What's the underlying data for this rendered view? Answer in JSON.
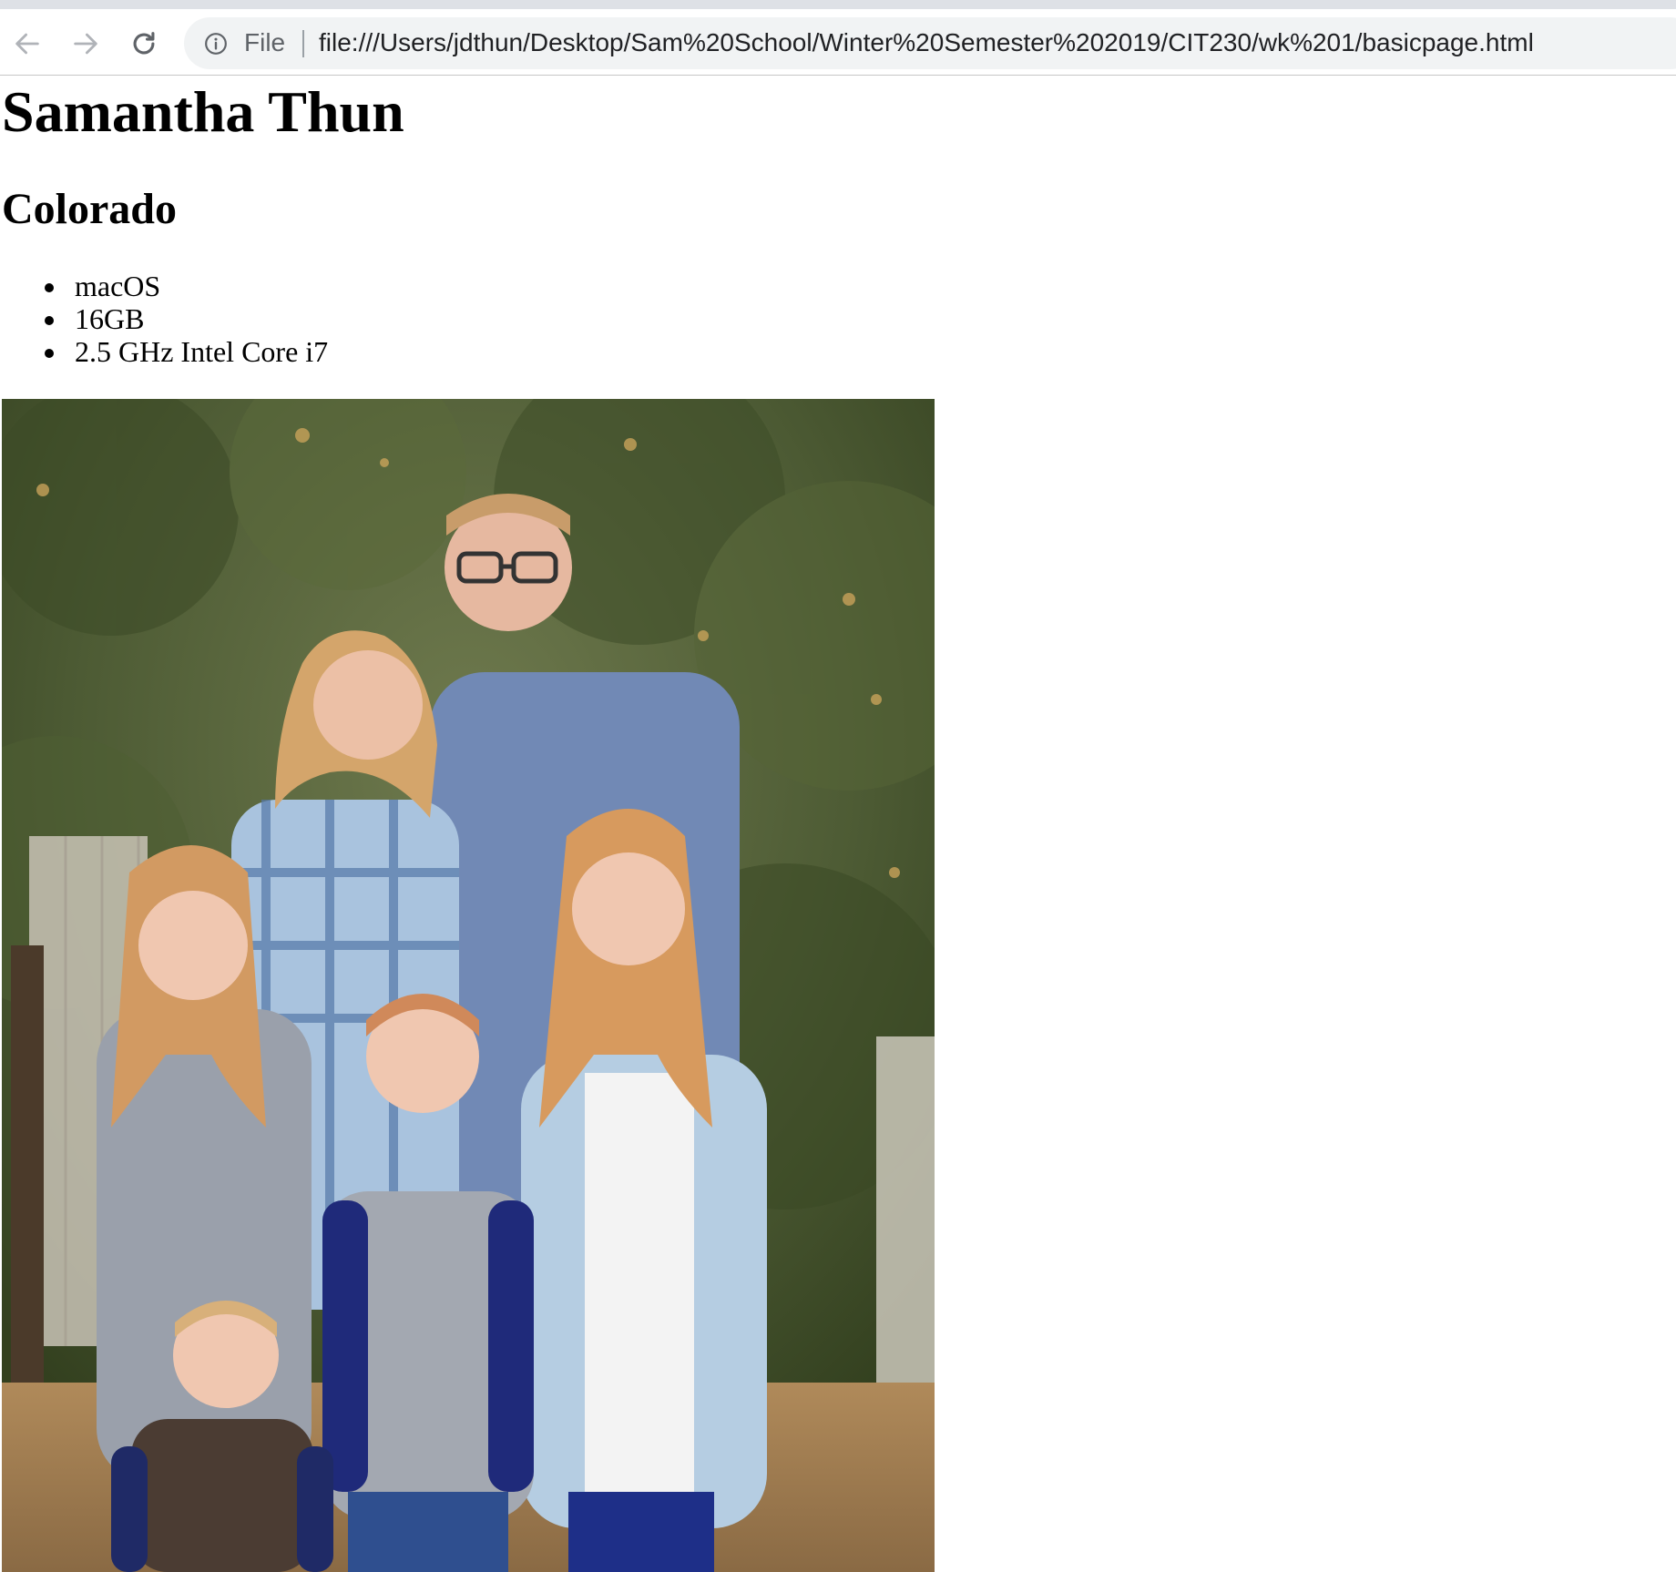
{
  "browser": {
    "back_icon": "arrow-left-icon",
    "forward_icon": "arrow-right-icon",
    "reload_icon": "reload-icon",
    "info_icon": "info-circle-icon",
    "scheme_chip": "File",
    "url": "file:///Users/jdthun/Desktop/Sam%20School/Winter%20Semester%202019/CIT230/wk%201/basicpage.html"
  },
  "page": {
    "title": "Samantha Thun",
    "subtitle": "Colorado",
    "specs": [
      "macOS",
      "16GB",
      "2.5 GHz Intel Core i7"
    ]
  },
  "colors": {
    "chrome_bg": "#dee1e6",
    "omnibox_bg": "#f1f3f4",
    "text": "#000000"
  }
}
